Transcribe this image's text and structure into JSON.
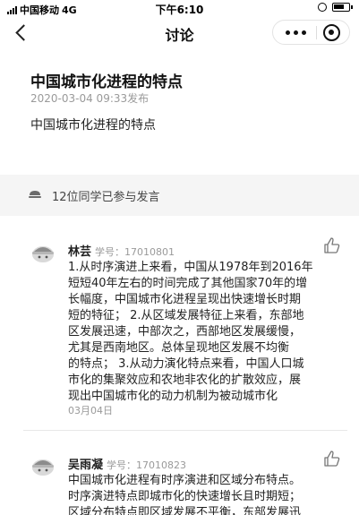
{
  "status_bar": {
    "carrier": "中国移动",
    "network": "4G",
    "time": "下午6:10"
  },
  "nav": {
    "title": "讨论"
  },
  "post": {
    "title": "中国城市化进程的特点",
    "date": "2020-03-04 09:33发布",
    "body": "中国城市化进程的特点"
  },
  "participants": {
    "text": "12位同学已参与发言"
  },
  "comments": [
    {
      "name": "林芸",
      "student_id": "学号：17010801",
      "text": "1.从时序演进上来看，中国从1978年到2016年\n短短40年左右的时间完成了其他国家70年的增\n长幅度，中国城市化进程呈现出快速增长时期\n短的特征；  2.从区域发展特征上来看，东部地\n区发展迅速，中部次之，西部地区发展缓慢，\n尤其是西南地区。总体呈现地区发展不均衡\n的特点；  3.从动力演化特点来看，中国人口城\n市化的集聚效应和农地非农化的扩散效应，展\n现出中国城市化的动力机制为被动城市化",
      "date": "03月04日"
    },
    {
      "name": "吴雨凝",
      "student_id": "学号：17010823",
      "text": "中国城市化进程有时序演进和区域分布特点。\n时序演进特点即城市化的快速增长且时期短；\n区域分布特点即区域发展不平衡，东部发展迅",
      "date": ""
    }
  ]
}
